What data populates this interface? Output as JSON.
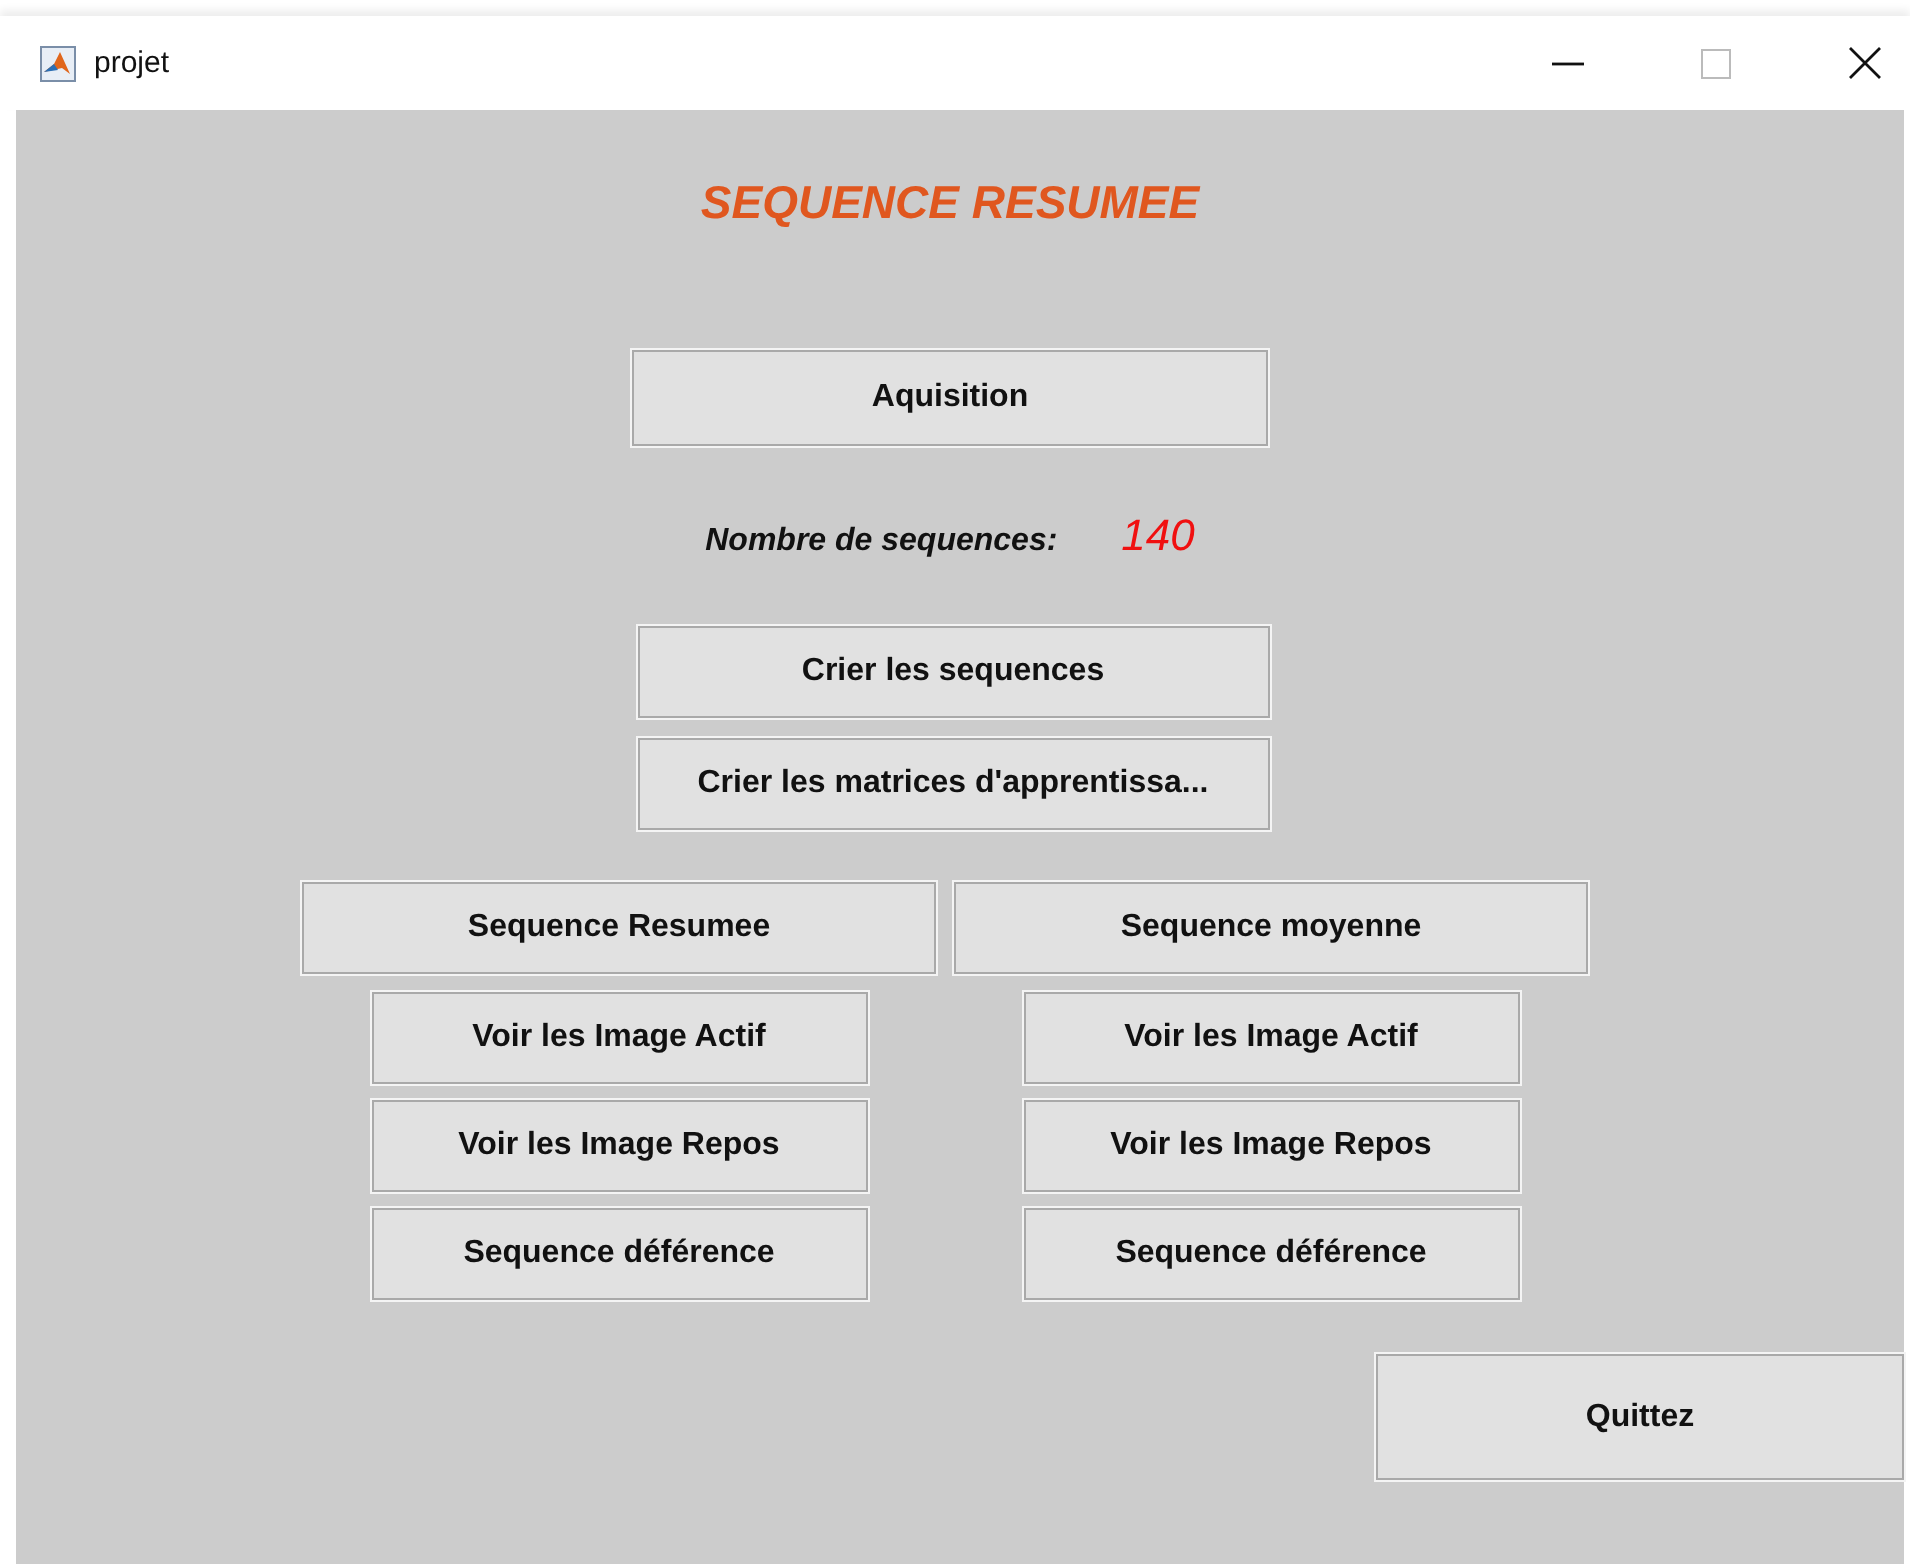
{
  "window": {
    "title": "projet"
  },
  "heading": "SEQUENCE RESUMEE",
  "acquisition_button": "Aquisition",
  "sequence_count": {
    "label": "Nombre de sequences:",
    "value": "140"
  },
  "actions": [
    "Crier les sequences",
    "Crier les matrices d'apprentissa..."
  ],
  "columns": [
    {
      "header": "Sequence Resumee",
      "buttons": [
        "Voir les Image Actif",
        "Voir les Image Repos",
        "Sequence déférence"
      ]
    },
    {
      "header": "Sequence moyenne",
      "buttons": [
        "Voir les Image Actif",
        "Voir les Image Repos",
        "Sequence déférence"
      ]
    }
  ],
  "quit_button": "Quittez"
}
